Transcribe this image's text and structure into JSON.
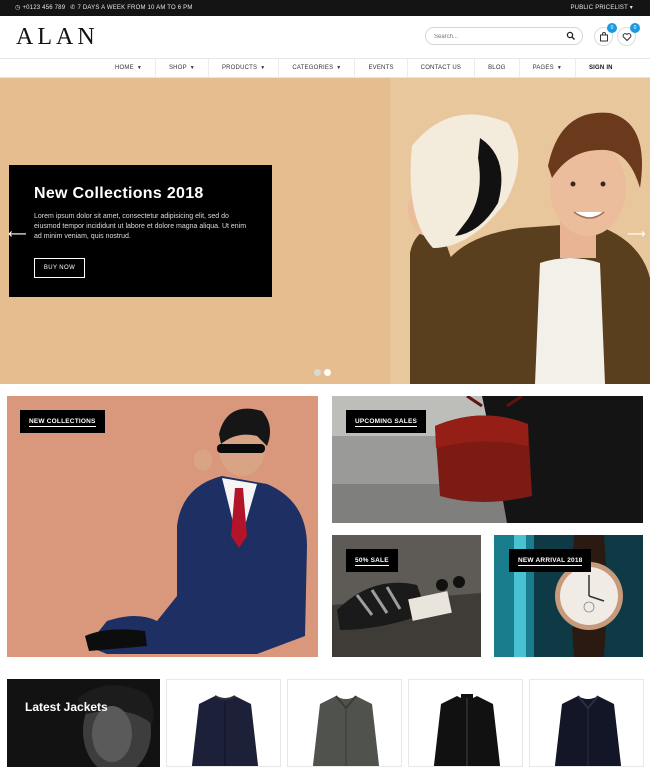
{
  "topbar": {
    "phone": "+0123 456 789",
    "hours": "7 DAYS A WEEK FROM 10 AM TO 6 PM",
    "pricelist": "PUBLIC PRICELIST"
  },
  "header": {
    "logo": "ALAN",
    "search_placeholder": "Search...",
    "cart_count": "0",
    "wishlist_count": "0"
  },
  "nav": {
    "items": [
      {
        "label": "HOME",
        "dropdown": true
      },
      {
        "label": "SHOP",
        "dropdown": true
      },
      {
        "label": "PRODUCTS",
        "dropdown": true
      },
      {
        "label": "CATEGORIES",
        "dropdown": true
      },
      {
        "label": "EVENTS",
        "dropdown": false
      },
      {
        "label": "CONTACT US",
        "dropdown": false
      },
      {
        "label": "BLOG",
        "dropdown": false
      },
      {
        "label": "PAGES",
        "dropdown": true
      },
      {
        "label": "SIGN IN",
        "dropdown": false
      }
    ]
  },
  "hero": {
    "title": "New Collections 2018",
    "text": "Lorem ipsum dolor sit amet, consectetur adipisicing elit, sed do eiusmod tempor incididunt ut labore et dolore magna aliqua. Ut enim ad minim veniam, quis nostrud.",
    "button": "BUY NOW",
    "prev_arrow": "⟵",
    "next_arrow": "⟶"
  },
  "banners": {
    "new_collections": "NEW COLLECTIONS",
    "upcoming_sales": "UPCOMING SALES",
    "sale": "50% SALE",
    "new_arrival": "NEW ARRIVAL 2018"
  },
  "products": {
    "latest_title": "Latest Jackets"
  },
  "colors": {
    "accent": "#1a9ae3",
    "hero_bg": "#e3b98a",
    "banner_peach": "#d9977b"
  }
}
